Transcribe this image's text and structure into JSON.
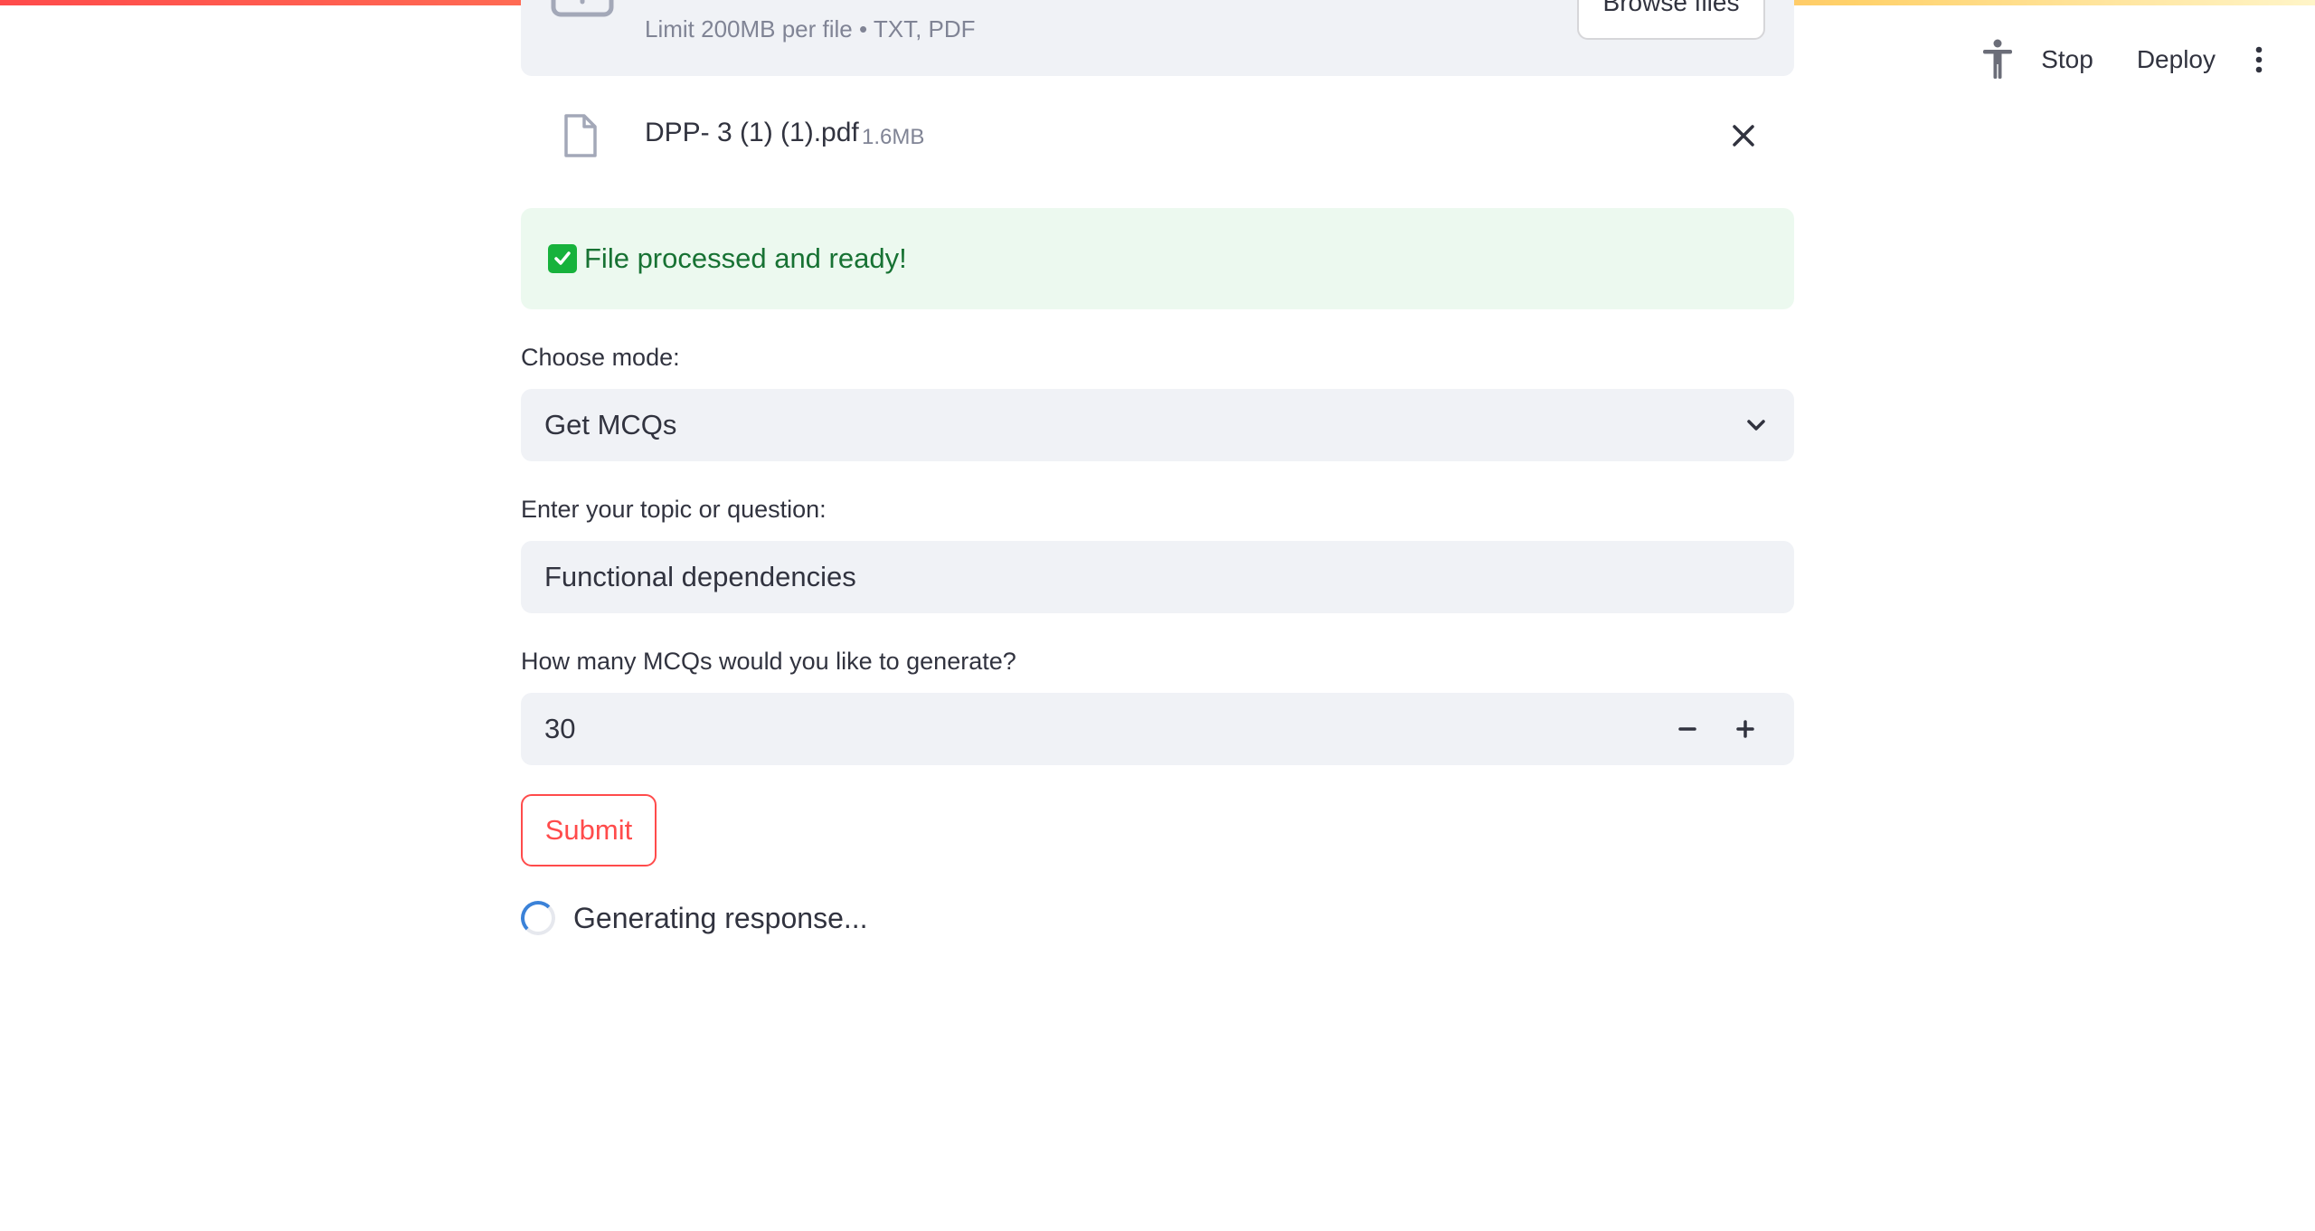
{
  "header": {
    "stop_label": "Stop",
    "deploy_label": "Deploy",
    "accessibility_icon": "accessibility-icon",
    "menu_icon": "more-vertical-icon"
  },
  "uploader": {
    "limit_text": "Limit 200MB per file • TXT, PDF",
    "browse_label": "Browse files",
    "upload_icon": "cloud-upload-icon"
  },
  "file": {
    "name": "DPP- 3 (1) (1).pdf",
    "size": "1.6MB",
    "file_icon": "file-icon",
    "remove_icon": "close-icon"
  },
  "success": {
    "message": "File processed and ready!",
    "icon": "check-icon"
  },
  "mode": {
    "label": "Choose mode:",
    "selected": "Get MCQs"
  },
  "topic": {
    "label": "Enter your topic or question:",
    "value": "Functional dependencies"
  },
  "count": {
    "label": "How many MCQs would you like to generate?",
    "value": "30"
  },
  "submit_label": "Submit",
  "status_text": "Generating response...",
  "colors": {
    "accent": "#ff4b4b",
    "success_bg": "#ecf9ef",
    "success_text": "#177233",
    "field_bg": "#f0f2f6"
  }
}
